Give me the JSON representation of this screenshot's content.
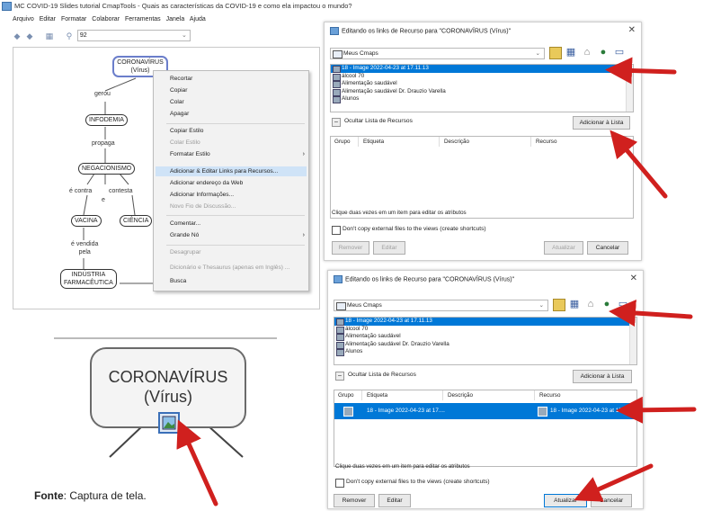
{
  "main_window": {
    "title": "MC COVID-19 Slides tutorial CmapTools - Quais as características da COVID-19 e como ela impactou o mundo?",
    "menu": [
      "Arquivo",
      "Editar",
      "Formatar",
      "Colaborar",
      "Ferramentas",
      "Janela",
      "Ajuda"
    ],
    "zoom_value": "92"
  },
  "concept_map": {
    "nodes": {
      "coronavirus": "CORONAVÍRUS\n(Vírus)",
      "infodemia": "INFODEMIA",
      "negacionismo": "NEGACIONISMO",
      "vacina": "VACINA",
      "ciencia": "CIÊNCIA",
      "industria": "INDÚSTRIA\nFARMACÊUTICA"
    },
    "links": {
      "gerou": "gerou",
      "propaga": "propaga",
      "e_contra": "é contra",
      "contesta": "contesta",
      "e": "e",
      "e_vendida_pela": "é vendida\npela"
    }
  },
  "context_menu": {
    "items": [
      {
        "label": "Recortar",
        "enabled": true
      },
      {
        "label": "Copiar",
        "enabled": true
      },
      {
        "label": "Colar",
        "enabled": true
      },
      {
        "label": "Apagar",
        "enabled": true
      },
      {
        "label": "Copiar Estilo",
        "enabled": true
      },
      {
        "label": "Colar Estilo",
        "enabled": false
      },
      {
        "label": "Formatar Estilo",
        "enabled": true
      },
      {
        "label": "Adicionar & Editar Links para Recursos...",
        "enabled": true
      },
      {
        "label": "Adicionar endereço da Web",
        "enabled": true
      },
      {
        "label": "Adicionar Informações...",
        "enabled": true
      },
      {
        "label": "Novo Fio de Discussão...",
        "enabled": false
      },
      {
        "label": "Comentar...",
        "enabled": true
      },
      {
        "label": "Grande Nó",
        "enabled": true
      },
      {
        "label": "Desagrupar",
        "enabled": false
      },
      {
        "label": "Dicionário e Thesaurus (apenas em Inglês) ...",
        "enabled": false
      },
      {
        "label": "Busca",
        "enabled": true
      }
    ]
  },
  "zoomed_node": {
    "line1": "CORONAVÍRUS",
    "line2": "(Vírus)"
  },
  "caption": {
    "bold": "Fonte",
    "rest": ": Captura de tela."
  },
  "dialog_top": {
    "title": "Editando os links de Recurso para \"CORONAVÍRUS (Vírus)\"",
    "combo": "Meus Cmaps",
    "resources": [
      "18 - Image 2022-04-23 at 17.11.13",
      "álcool 70",
      "Alimentação saudável",
      "Alimentação saudável Dr. Drauzio Varella",
      "Alunos"
    ],
    "hide_list": "Ocultar Lista de Recursos",
    "add_to_list": "Adicionar à Lista",
    "columns": [
      "Grupo",
      "Etiqueta",
      "Descrição",
      "Recurso"
    ],
    "hint": "Clique duas vezes em um item para editar os atributos",
    "checkbox": "Don't copy external files to the views (create shortcuts)",
    "remove": "Remover",
    "edit": "Editar",
    "update": "Atualizar",
    "cancel": "Cancelar"
  },
  "dialog_bottom": {
    "title": "Editando os links de Recurso para \"CORONAVÍRUS (Vírus)\"",
    "combo": "Meus Cmaps",
    "resources": [
      "18 - Image 2022-04-23 at 17.11.13",
      "álcool 70",
      "Alimentação saudável",
      "Alimentação saudável Dr. Drauzio Varella",
      "Alunos"
    ],
    "hide_list": "Ocultar Lista de Recursos",
    "add_to_list": "Adicionar à Lista",
    "columns": [
      "Grupo",
      "Etiqueta",
      "Descrição",
      "Recurso"
    ],
    "row": {
      "etiqueta": "18 - Image 2022-04-23 at 17....",
      "recurso": "18 - Image 2022-04-23 at 17.1..."
    },
    "hint": "Clique duas vezes em um item para editar os atributos",
    "checkbox": "Don't copy external files to the views (create shortcuts)",
    "remove": "Remover",
    "edit": "Editar",
    "update": "Atualizar",
    "cancel": "Cancelar"
  },
  "colors": {
    "arrow": "#d0201e",
    "selection": "#0078d7",
    "node_highlight": "#6b7ecb"
  }
}
